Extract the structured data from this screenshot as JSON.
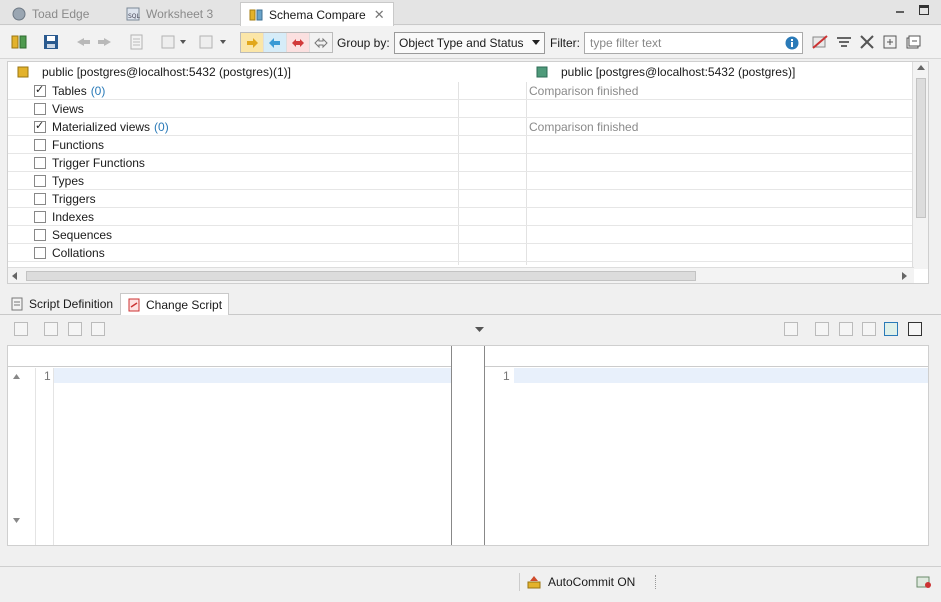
{
  "tabs": [
    {
      "label": "Toad Edge",
      "icon": "globe-icon",
      "active": false
    },
    {
      "label": "Worksheet 3",
      "icon": "sql-icon",
      "active": false
    },
    {
      "label": "Schema Compare",
      "icon": "schema-compare-icon",
      "active": true
    }
  ],
  "toolbar": {
    "group_by_label": "Group by:",
    "group_by_value": "Object Type and Status",
    "filter_label": "Filter:",
    "filter_placeholder": "type filter text"
  },
  "tree": {
    "left_header": "public [postgres@localhost:5432 (postgres)(1)]",
    "right_header": "public [postgres@localhost:5432 (postgres)]",
    "rows": [
      {
        "label": "Tables",
        "count": "(0)",
        "checked": true,
        "status": "Comparison finished"
      },
      {
        "label": "Views",
        "count": "",
        "checked": false,
        "status": ""
      },
      {
        "label": "Materialized views",
        "count": "(0)",
        "checked": true,
        "status": "Comparison finished"
      },
      {
        "label": "Functions",
        "count": "",
        "checked": false,
        "status": ""
      },
      {
        "label": "Trigger Functions",
        "count": "",
        "checked": false,
        "status": ""
      },
      {
        "label": "Types",
        "count": "",
        "checked": false,
        "status": ""
      },
      {
        "label": "Triggers",
        "count": "",
        "checked": false,
        "status": ""
      },
      {
        "label": "Indexes",
        "count": "",
        "checked": false,
        "status": ""
      },
      {
        "label": "Sequences",
        "count": "",
        "checked": false,
        "status": ""
      },
      {
        "label": "Collations",
        "count": "",
        "checked": false,
        "status": ""
      }
    ]
  },
  "lower_tabs": [
    {
      "label": "Script Definition",
      "active": false
    },
    {
      "label": "Change Script",
      "active": true
    }
  ],
  "editor": {
    "left_line": "1",
    "right_line": "1"
  },
  "statusbar": {
    "autocommit": "AutoCommit ON"
  },
  "colors": {
    "accent": "#2a7ab8",
    "highlight": "#e8f0fb"
  }
}
